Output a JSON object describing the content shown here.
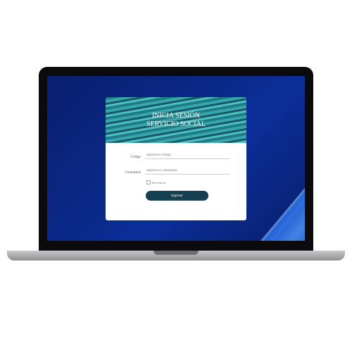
{
  "login": {
    "title_line1": "INICIA SESIÓN",
    "title_line2": "SERVICIO SOCIAL",
    "code_label": "Código",
    "code_placeholder": "Ingresa tu código",
    "password_label": "Contraseña",
    "password_placeholder": "Ingresa tu Contraseña",
    "remember_label": "Recordarme",
    "submit_label": "Ingresar"
  },
  "colors": {
    "button": "#163f4f",
    "header": "#38a7ad",
    "wallpaper": "#0a2a8a"
  }
}
